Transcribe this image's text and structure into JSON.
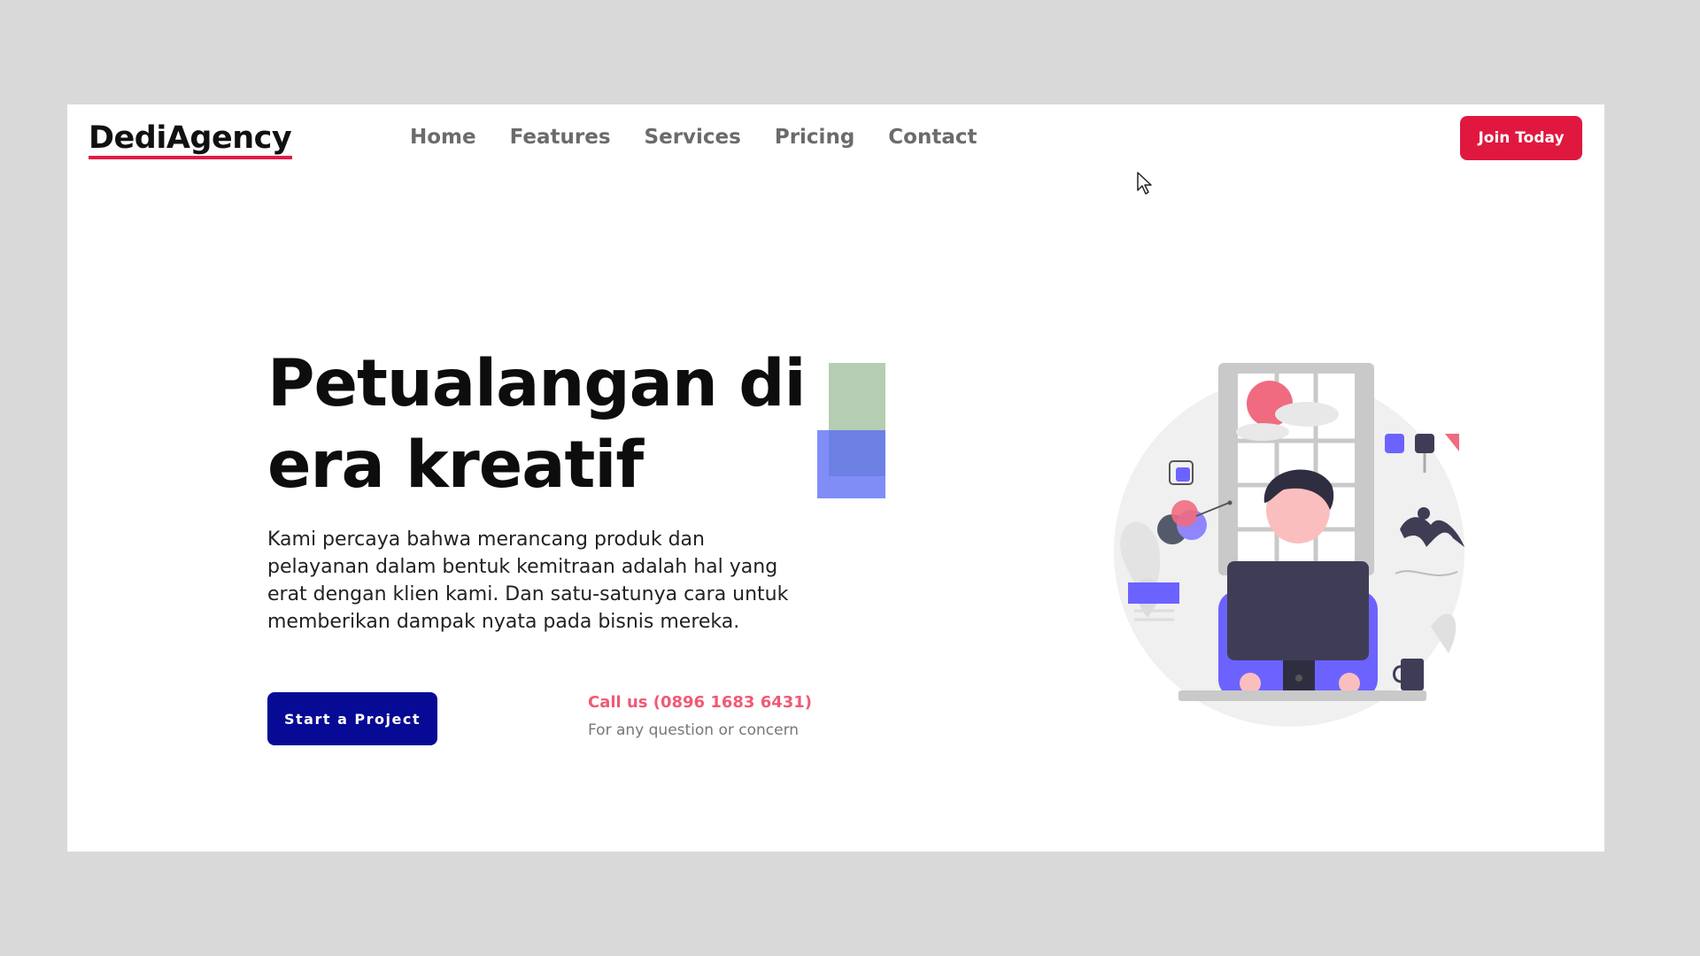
{
  "header": {
    "logo": "DediAgency",
    "nav": [
      "Home",
      "Features",
      "Services",
      "Pricing",
      "Contact"
    ],
    "cta_label": "Join Today"
  },
  "hero": {
    "title_line1": "Petualangan di",
    "title_line2": "era kreatif",
    "description": "Kami percaya bahwa merancang produk dan pelayanan dalam bentuk kemitraan adalah hal yang erat dengan klien kami. Dan satu-satunya cara untuk memberikan dampak nyata pada bisnis mereka.",
    "primary_button": "Start a Project",
    "call_label": "Call us (0896 1683 6431)",
    "call_sub": "For any question or concern"
  },
  "colors": {
    "accent_red": "#e0183f",
    "primary_blue": "#070a94",
    "call_pink": "#ef5a74",
    "illustration_purple": "#6c63ff"
  },
  "icons": {
    "cursor": "mouse-pointer-icon",
    "illustration": "person-at-computer-illustration"
  }
}
